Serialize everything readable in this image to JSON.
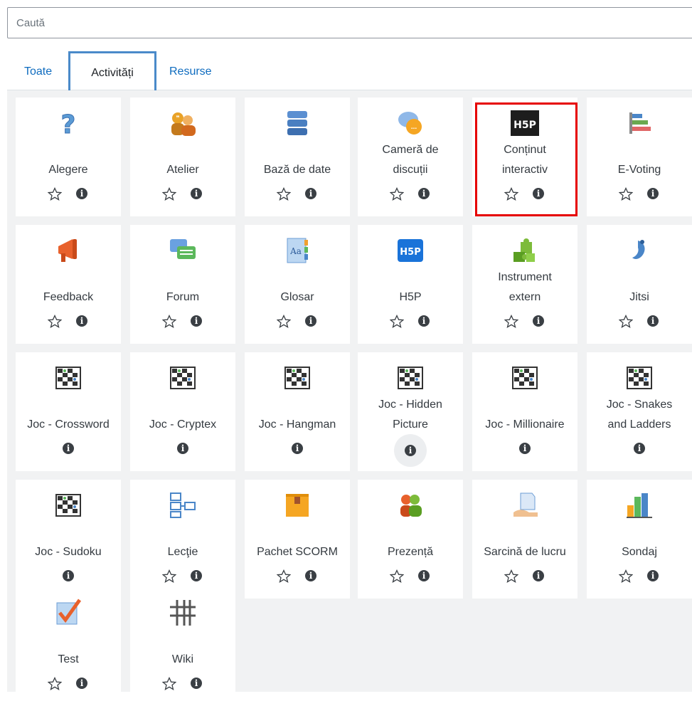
{
  "search": {
    "placeholder": "Caută"
  },
  "tabs": [
    {
      "label": "Toate"
    },
    {
      "label": "Activități"
    },
    {
      "label": "Resurse"
    }
  ],
  "items": [
    {
      "name": "Alegere",
      "icon": "question-icon",
      "has_star": true
    },
    {
      "name": "Atelier",
      "icon": "workshop-icon",
      "has_star": true
    },
    {
      "name": "Bază de date",
      "icon": "database-icon",
      "has_star": true
    },
    {
      "name": "Cameră de discuții",
      "line1": "Cameră de",
      "line2": "discuții",
      "icon": "chat-icon",
      "has_star": true
    },
    {
      "name": "Conținut interactiv",
      "line1": "Conținut",
      "line2": "interactiv",
      "icon": "h5p-dark-icon",
      "has_star": true
    },
    {
      "name": "E-Voting",
      "icon": "evoting-icon",
      "has_star": true
    },
    {
      "name": "Feedback",
      "icon": "megaphone-icon",
      "has_star": true
    },
    {
      "name": "Forum",
      "icon": "forum-icon",
      "has_star": true
    },
    {
      "name": "Glosar",
      "icon": "glossary-icon",
      "has_star": true
    },
    {
      "name": "H5P",
      "icon": "h5p-blue-icon",
      "has_star": true
    },
    {
      "name": "Instrument extern",
      "line1": "Instrument",
      "line2": "extern",
      "icon": "puzzle-icon",
      "has_star": true
    },
    {
      "name": "Jitsi",
      "icon": "jitsi-icon",
      "has_star": true
    },
    {
      "name": "Joc - Crossword",
      "icon": "game-icon",
      "has_star": false
    },
    {
      "name": "Joc - Cryptex",
      "icon": "game-icon",
      "has_star": false
    },
    {
      "name": "Joc - Hangman",
      "icon": "game-icon",
      "has_star": false
    },
    {
      "name": "Joc - Hidden Picture",
      "line1": "Joc - Hidden",
      "line2": "Picture",
      "icon": "game-icon",
      "has_star": false
    },
    {
      "name": "Joc - Millionaire",
      "icon": "game-icon",
      "has_star": false
    },
    {
      "name": "Joc - Snakes and Ladders",
      "line1": "Joc - Snakes",
      "line2": "and Ladders",
      "icon": "game-icon",
      "has_star": false
    },
    {
      "name": "Joc - Sudoku",
      "icon": "game-icon",
      "has_star": false
    },
    {
      "name": "Lecţie",
      "icon": "lesson-icon",
      "has_star": true
    },
    {
      "name": "Pachet SCORM",
      "icon": "scorm-icon",
      "has_star": true
    },
    {
      "name": "Prezență",
      "icon": "attendance-icon",
      "has_star": true
    },
    {
      "name": "Sarcină de lucru",
      "icon": "assignment-icon",
      "has_star": true
    },
    {
      "name": "Sondaj",
      "icon": "survey-icon",
      "has_star": true
    },
    {
      "name": "Test",
      "icon": "quiz-icon",
      "has_star": true
    },
    {
      "name": "Wiki",
      "icon": "wiki-icon",
      "has_star": true
    }
  ],
  "colors": {
    "link": "#0f6cbf",
    "highlight": "#e60000",
    "active_tab_border": "#4a8ac9"
  }
}
